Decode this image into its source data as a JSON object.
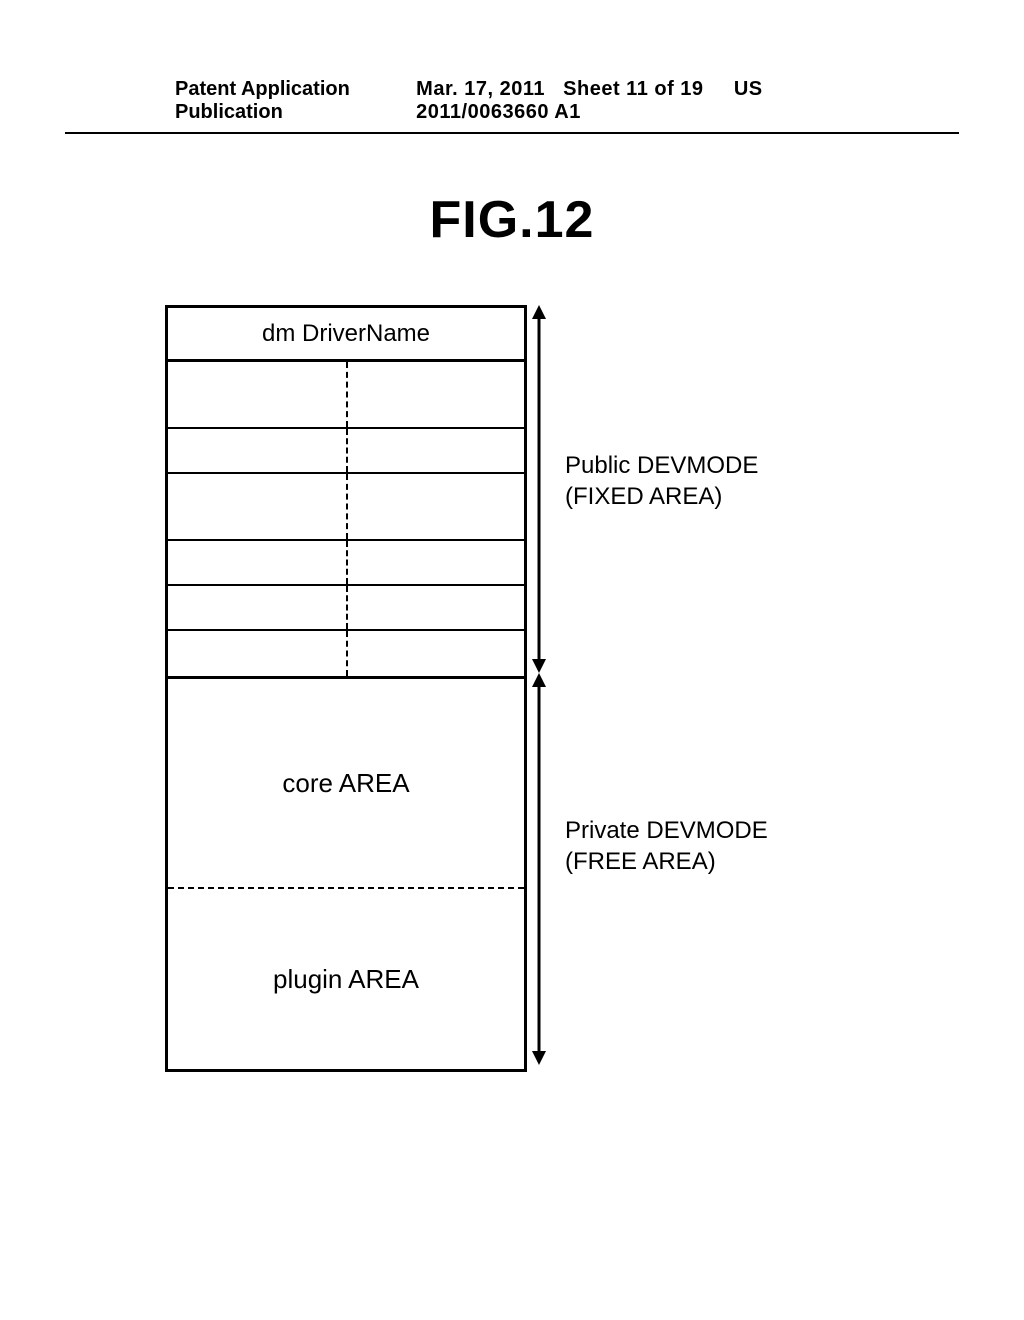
{
  "header": {
    "left": "Patent Application Publication",
    "date": "Mar. 17, 2011",
    "sheet": "Sheet 11 of 19",
    "pubno": "US 2011/0063660 A1"
  },
  "figure": {
    "title": "FIG.12",
    "driver_name": "dm DriverName",
    "core_area": "core AREA",
    "plugin_area": "plugin AREA",
    "public_label_line1": "Public DEVMODE",
    "public_label_line2": "(FIXED AREA)",
    "private_label_line1": "Private DEVMODE",
    "private_label_line2": "(FREE AREA)"
  }
}
